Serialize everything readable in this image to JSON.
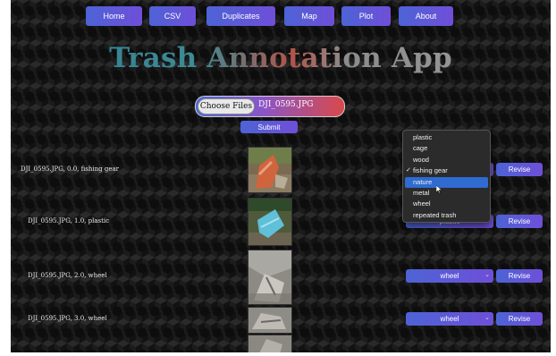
{
  "nav": {
    "items": [
      "Home",
      "CSV",
      "Duplicates",
      "Map",
      "Plot",
      "About"
    ]
  },
  "header": {
    "title": "Trash Annotation App"
  },
  "upload": {
    "choose_label": "Choose Files",
    "file_name": "DJI_0595.JPG",
    "submit_label": "Submit"
  },
  "rows": [
    {
      "label": "DJI_0595.JPG, 0.0, fishing gear",
      "selected": "fishing gear",
      "revise": "Revise"
    },
    {
      "label": "DJI_0595.JPG, 1.0, plastic",
      "selected": "plastic",
      "revise": "Revise"
    },
    {
      "label": "DJI_0595.JPG, 2.0, wheel",
      "selected": "wheel",
      "revise": "Revise"
    },
    {
      "label": "DJI_0595.JPG, 3.0, wheel",
      "selected": "wheel",
      "revise": "Revise"
    }
  ],
  "dropdown": {
    "options": [
      "plastic",
      "cage",
      "wood",
      "fishing gear",
      "nature",
      "metal",
      "wheel",
      "repeated trash"
    ],
    "checked": "fishing gear",
    "highlighted": "nature"
  },
  "colors": {
    "button_start": "#4d63d6",
    "button_end": "#6f4fd8",
    "highlight": "#2f6bd0",
    "background": "#121212"
  }
}
